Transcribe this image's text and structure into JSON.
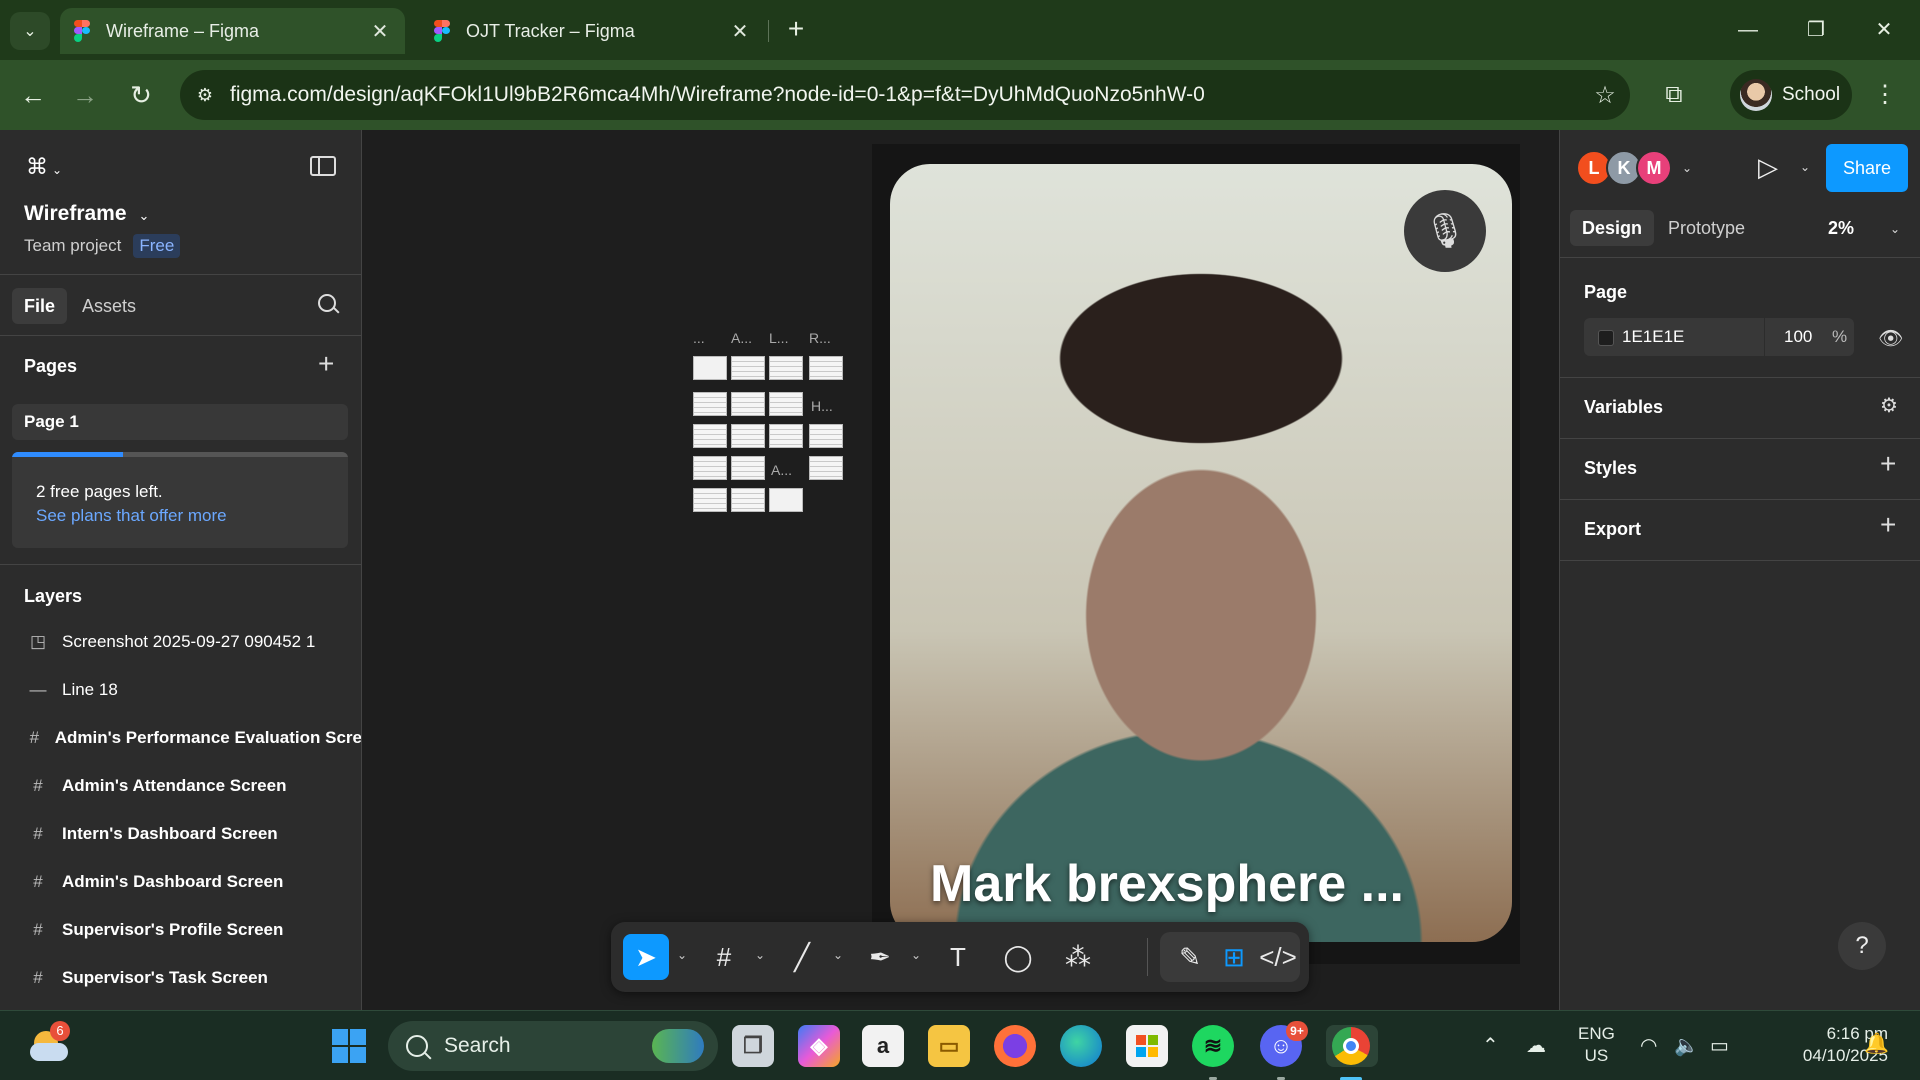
{
  "browser": {
    "tabs": [
      {
        "title": "Wireframe – Figma",
        "active": true
      },
      {
        "title": "OJT Tracker – Figma",
        "active": false
      }
    ],
    "url": "figma.com/design/aqKFOkl1Ul9bB2R6mca4Mh/Wireframe?node-id=0-1&p=f&t=DyUhMdQuoNzo5nhW-0",
    "profile_label": "School",
    "colors": {
      "frame": "#1f3a1a",
      "toolbar": "#2f5229"
    }
  },
  "figma": {
    "file_name": "Wireframe",
    "team_label": "Team project",
    "plan_badge": "Free",
    "left_tabs": [
      "File",
      "Assets"
    ],
    "pages_heading": "Pages",
    "pages": [
      "Page 1"
    ],
    "upsell": {
      "line1": "2 free pages left.",
      "line2": "See plans that offer more",
      "progress": 0.33
    },
    "layers_heading": "Layers",
    "layers": [
      {
        "icon": "image-icon",
        "glyph": "◳",
        "name": "Screenshot 2025-09-27 090452 1",
        "bold": false
      },
      {
        "icon": "line-icon",
        "glyph": "—",
        "name": "Line 18",
        "bold": false
      },
      {
        "icon": "frame-icon",
        "glyph": "#",
        "name": "Admin's Performance Evaluation Scre",
        "bold": true
      },
      {
        "icon": "frame-icon",
        "glyph": "#",
        "name": "Admin's Attendance Screen",
        "bold": true
      },
      {
        "icon": "frame-icon",
        "glyph": "#",
        "name": "Intern's Dashboard Screen",
        "bold": true
      },
      {
        "icon": "frame-icon",
        "glyph": "#",
        "name": "Admin's Dashboard Screen",
        "bold": true
      },
      {
        "icon": "frame-icon",
        "glyph": "#",
        "name": "Supervisor's Profile Screen",
        "bold": true
      },
      {
        "icon": "frame-icon",
        "glyph": "#",
        "name": "Supervisor's Task Screen",
        "bold": true
      }
    ],
    "canvas_thumb_labels": [
      "...",
      "A...",
      "L...",
      "R...",
      "H...",
      "A..."
    ],
    "video_overlay_name": "Mark brexsphere ...",
    "collaborators": [
      {
        "initial": "L",
        "color": "#f24e1e"
      },
      {
        "initial": "K",
        "color": "#8e9aa6"
      },
      {
        "initial": "M",
        "color": "#e8407a"
      }
    ],
    "share_label": "Share",
    "right_tabs": [
      "Design",
      "Prototype"
    ],
    "zoom": "2%",
    "page_section": {
      "title": "Page",
      "bg_hex": "1E1E1E",
      "opacity": "100",
      "pct": "%"
    },
    "sections": [
      "Variables",
      "Styles",
      "Export"
    ],
    "help_label": "?"
  },
  "taskbar": {
    "weather_badge": "6",
    "search_label": "Search",
    "discord_badge": "9+",
    "lang": [
      "ENG",
      "US"
    ],
    "time": "6:16 pm",
    "date": "04/10/2025"
  }
}
